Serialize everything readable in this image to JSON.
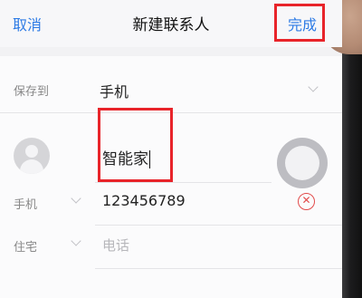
{
  "header": {
    "cancel_label": "取消",
    "title": "新建联系人",
    "done_label": "完成"
  },
  "form": {
    "save_to": {
      "label": "保存到",
      "value": "手机"
    },
    "name": {
      "value": "智能家"
    },
    "phone": {
      "type_label": "手机",
      "value": "123456789",
      "clear_icon": "x-circle-icon"
    },
    "home": {
      "type_label": "住宅",
      "placeholder": "电话"
    }
  },
  "colors": {
    "accent": "#2d7be5",
    "highlight": "#e8242a",
    "clear": "#e24b4b"
  }
}
